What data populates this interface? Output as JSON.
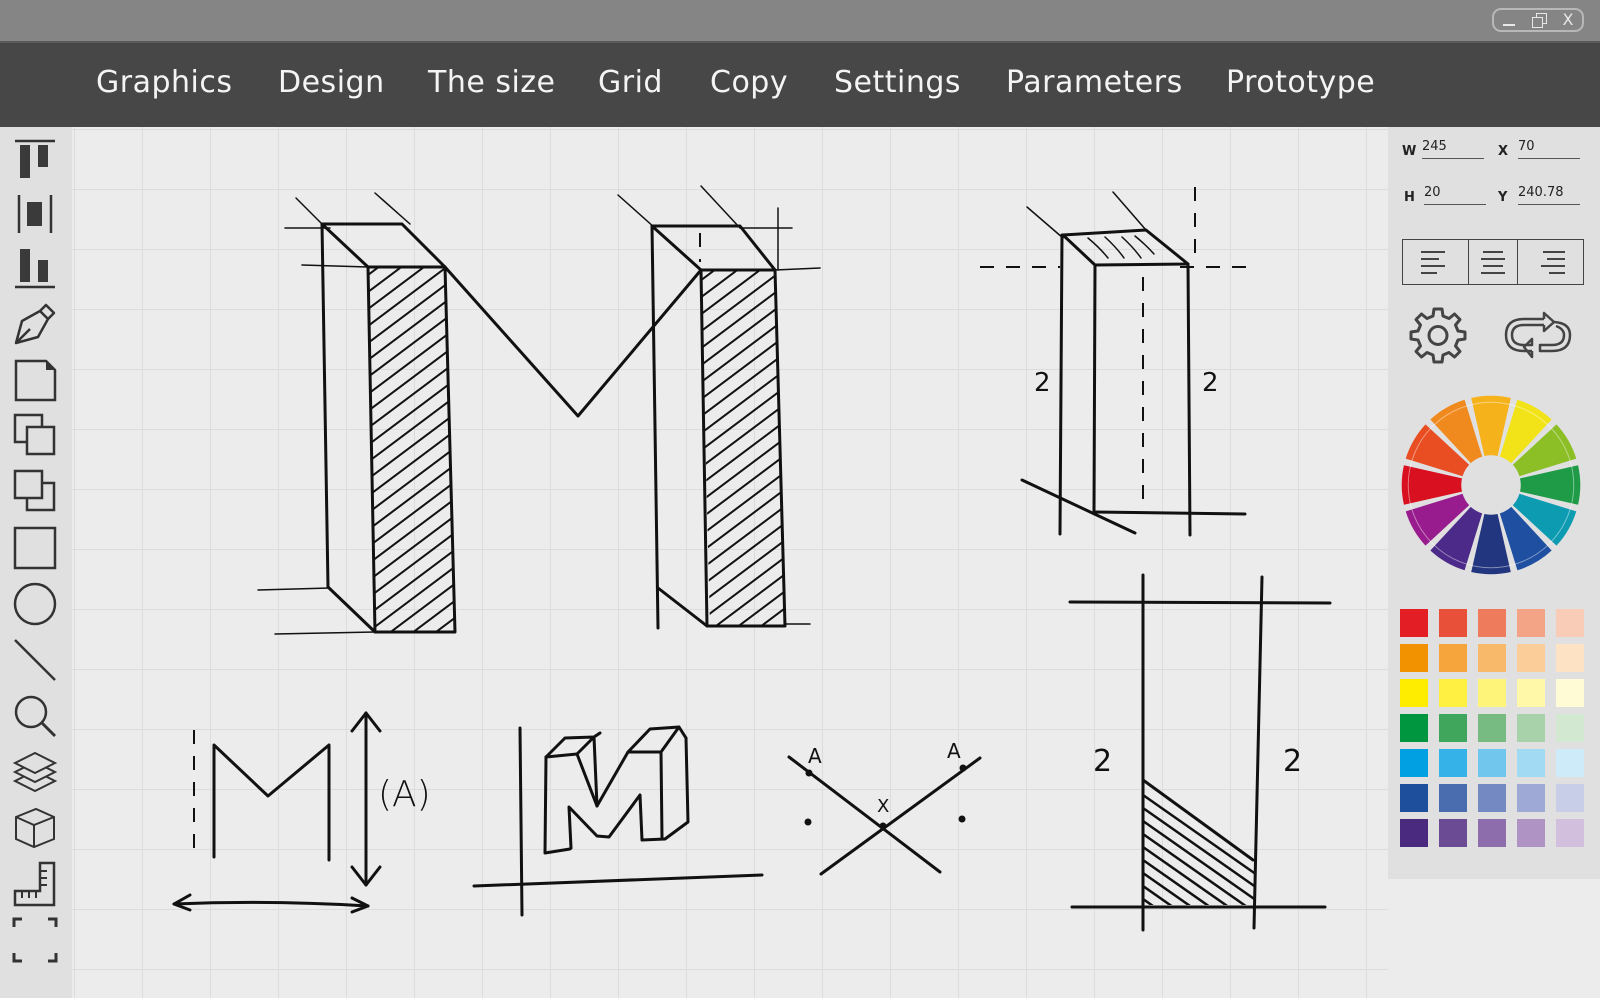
{
  "window": {
    "controls": {
      "minimize_icon": "minimize-icon",
      "restore_icon": "restore-icon",
      "close_label": "X"
    }
  },
  "menu": {
    "items": [
      {
        "label": "Graphics"
      },
      {
        "label": "Design"
      },
      {
        "label": "The size"
      },
      {
        "label": "Grid"
      },
      {
        "label": "Copy"
      },
      {
        "label": "Settings"
      },
      {
        "label": "Parameters"
      },
      {
        "label": "Prototype"
      }
    ]
  },
  "toolbar": {
    "tools": [
      "align-top-icon",
      "align-center-icon",
      "align-bottom-icon",
      "pen-tool-icon",
      "new-page-icon",
      "bring-forward-icon",
      "send-backward-icon",
      "rectangle-icon",
      "ellipse-icon",
      "line-icon",
      "zoom-icon",
      "layers-icon",
      "3d-cube-icon",
      "ruler-icon",
      "fullscreen-icon"
    ]
  },
  "properties": {
    "w": {
      "label": "W",
      "value": "245"
    },
    "x": {
      "label": "X",
      "value": "70"
    },
    "h": {
      "label": "H",
      "value": "20"
    },
    "y": {
      "label": "Y",
      "value": "240.78"
    },
    "text_align": [
      "align-left",
      "align-center",
      "align-right"
    ],
    "color_wheel": [
      "#f6b21b",
      "#f2e318",
      "#8cbf26",
      "#1f9b48",
      "#0d9bb2",
      "#1e4fa1",
      "#22357f",
      "#4c2a8a",
      "#981c8d",
      "#d8101f",
      "#e94e23",
      "#f08a1e"
    ],
    "palette": [
      [
        "#e31e24",
        "#e8503a",
        "#ee7b5c",
        "#f4a486",
        "#f9ccb8"
      ],
      [
        "#f39200",
        "#f6a53c",
        "#f8b96b",
        "#fbcd98",
        "#fde2c4"
      ],
      [
        "#ffed00",
        "#fff042",
        "#fff47a",
        "#fff8a8",
        "#fffbd4"
      ],
      [
        "#009640",
        "#3fa65b",
        "#78bb82",
        "#a8d2a9",
        "#d2e8d0"
      ],
      [
        "#00a0e3",
        "#35b2e7",
        "#70c6ed",
        "#a2d9f3",
        "#cdebf8"
      ],
      [
        "#1d4f9c",
        "#4a6db0",
        "#7489c2",
        "#9eaad5",
        "#c8cde8"
      ],
      [
        "#4a2a7e",
        "#6c4b95",
        "#8d6dac",
        "#ae93c4",
        "#d1bfdd"
      ]
    ]
  },
  "canvas": {
    "annotations": {
      "dim_left_top": "2",
      "dim_right_top": "2",
      "dim_left_bottom": "2",
      "dim_right_bottom": "2",
      "label_a_paren": "(A)",
      "point_a_left": "A",
      "point_a_right": "A",
      "point_x": "X"
    }
  }
}
